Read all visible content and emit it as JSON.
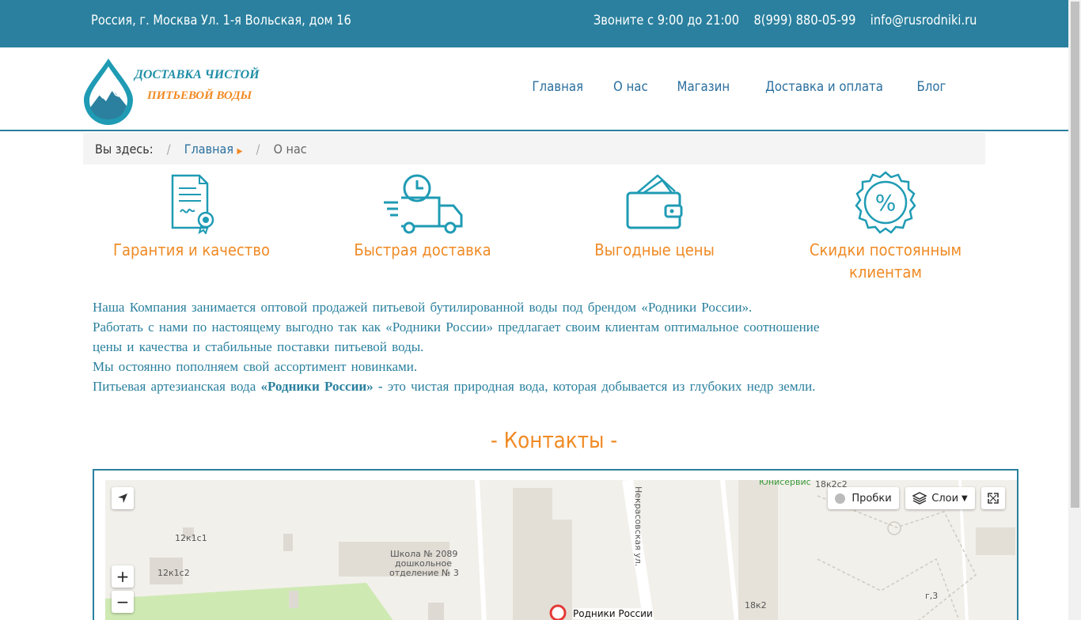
{
  "topbar": {
    "address": "Россия, г. Москва Ул. 1-я Вольская, дом 16",
    "hours": "Звоните с 9:00 до 21:00",
    "phone": "8(999) 880-05-99",
    "email": "info@rusrodniki.ru"
  },
  "logo": {
    "line1": "ДОСТАВКА ЧИСТОЙ",
    "line2": "ПИТЬЕВОЙ ВОДЫ"
  },
  "nav": [
    "Главная",
    "О нас",
    "Магазин",
    "Доставка и оплата",
    "Блог"
  ],
  "breadcrumb": {
    "prefix": "Вы здесь:",
    "home": "Главная",
    "current": "О нас"
  },
  "features": [
    {
      "icon": "certificate-icon",
      "label": "Гарантия и качество"
    },
    {
      "icon": "delivery-truck-icon",
      "label": "Быстрая доставка"
    },
    {
      "icon": "wallet-icon",
      "label": "Выгодные цены"
    },
    {
      "icon": "discount-badge-icon",
      "label": "Скидки постоянным клиентам"
    }
  ],
  "about": {
    "p1": "Наша Компания  занимается  оптовой  продажей  питьевой бутилированной  воды  под  брендом  «Родники России».",
    "p2": "Работать  с  нами  по настоящему  выгодно так как «Родники России» предлагает своим клиентам  оптимальное  соотношение",
    "p3": "цены  и  качества и стабильные поставки питьевой воды.",
    "p4": "Мы остоянно пополняем свой ассортимент новинками.",
    "p5_start": "Питьевая  артезианская вода  ",
    "p5_bold": "«Родники России» -",
    "p5_end": " это чистая  природная вода, которая добывается  из глубоких недр земли."
  },
  "contacts": {
    "title": "- Контакты -"
  },
  "map": {
    "traffic_label": "Пробки",
    "layers_label": "Слои",
    "zoom_in": "+",
    "zoom_out": "−",
    "labels": {
      "b1": "12к1с1",
      "b2": "12к1с2",
      "school1": "Школа № 2089",
      "school2": "дошкольное",
      "school3": "отделение № 3",
      "street": "Некрасовская ул.",
      "org": "Юнисервис",
      "b3": "18к2с2",
      "b4": "18к2",
      "b5": "г,3",
      "marker": "Родники России"
    }
  },
  "colors": {
    "primary": "#2a809e",
    "accent": "#f08a24"
  }
}
